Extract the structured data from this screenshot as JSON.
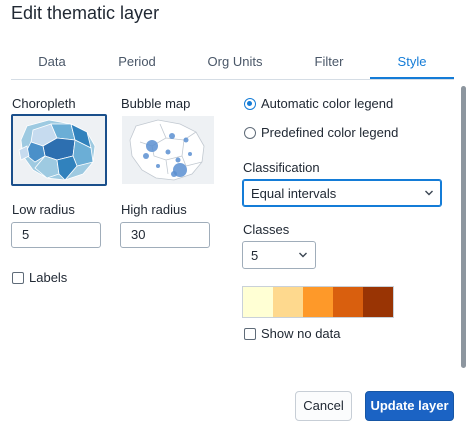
{
  "dialog": {
    "title": "Edit thematic layer"
  },
  "tabs": [
    {
      "label": "Data"
    },
    {
      "label": "Period"
    },
    {
      "label": "Org Units"
    },
    {
      "label": "Filter"
    },
    {
      "label": "Style",
      "active": true
    }
  ],
  "style": {
    "map_types": [
      {
        "label": "Choropleth",
        "selected": true
      },
      {
        "label": "Bubble map",
        "selected": false
      }
    ],
    "low_radius": {
      "label": "Low radius",
      "value": "5"
    },
    "high_radius": {
      "label": "High radius",
      "value": "30"
    },
    "labels_checkbox": {
      "label": "Labels",
      "checked": false
    },
    "legend_options": [
      {
        "label": "Automatic color legend",
        "checked": true
      },
      {
        "label": "Predefined color legend",
        "checked": false
      }
    ],
    "classification": {
      "label": "Classification",
      "value": "Equal intervals"
    },
    "classes": {
      "label": "Classes",
      "value": "5"
    },
    "color_scale": [
      "#ffffd4",
      "#fed98e",
      "#fe9929",
      "#d95f0e",
      "#993404"
    ],
    "show_no_data": {
      "label": "Show no data",
      "checked": false
    }
  },
  "footer": {
    "cancel_label": "Cancel",
    "update_label": "Update layer"
  },
  "colors": {
    "accent": "#147cd7",
    "primary_button": "#1b63c4"
  }
}
